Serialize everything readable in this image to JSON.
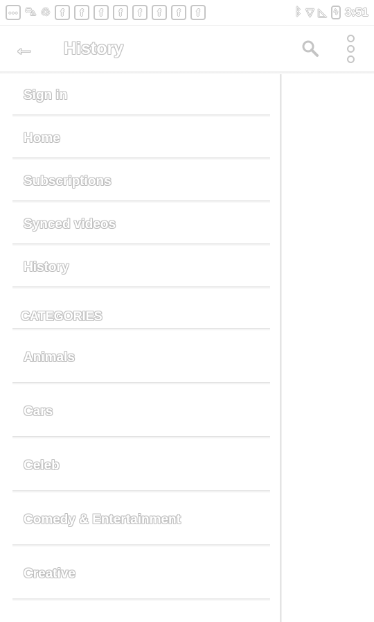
{
  "status_bar": {
    "time": "3:51",
    "left_icons": [
      "message-icon",
      "car-icon",
      "recycle-icon",
      "facebook-icon",
      "facebook-icon",
      "facebook-icon",
      "facebook-icon",
      "facebook-icon",
      "facebook-icon",
      "facebook-icon",
      "facebook-icon"
    ],
    "right_icons": [
      "bluetooth-icon",
      "wifi-icon",
      "no-sim-icon",
      "battery-icon"
    ]
  },
  "appbar": {
    "title": "History",
    "back_icon": "arrow-left-icon",
    "search_icon": "search-icon",
    "more_icon": "more-vert-icon"
  },
  "drawer": {
    "items": [
      {
        "label": "Sign in"
      },
      {
        "label": "Home"
      },
      {
        "label": "Subscriptions"
      },
      {
        "label": "Synced videos"
      },
      {
        "label": "History"
      }
    ],
    "categories_header": "CATEGORIES",
    "categories": [
      {
        "label": "Animals"
      },
      {
        "label": "Cars"
      },
      {
        "label": "Celeb"
      },
      {
        "label": "Comedy & Entertainment"
      },
      {
        "label": "Creative"
      }
    ]
  }
}
